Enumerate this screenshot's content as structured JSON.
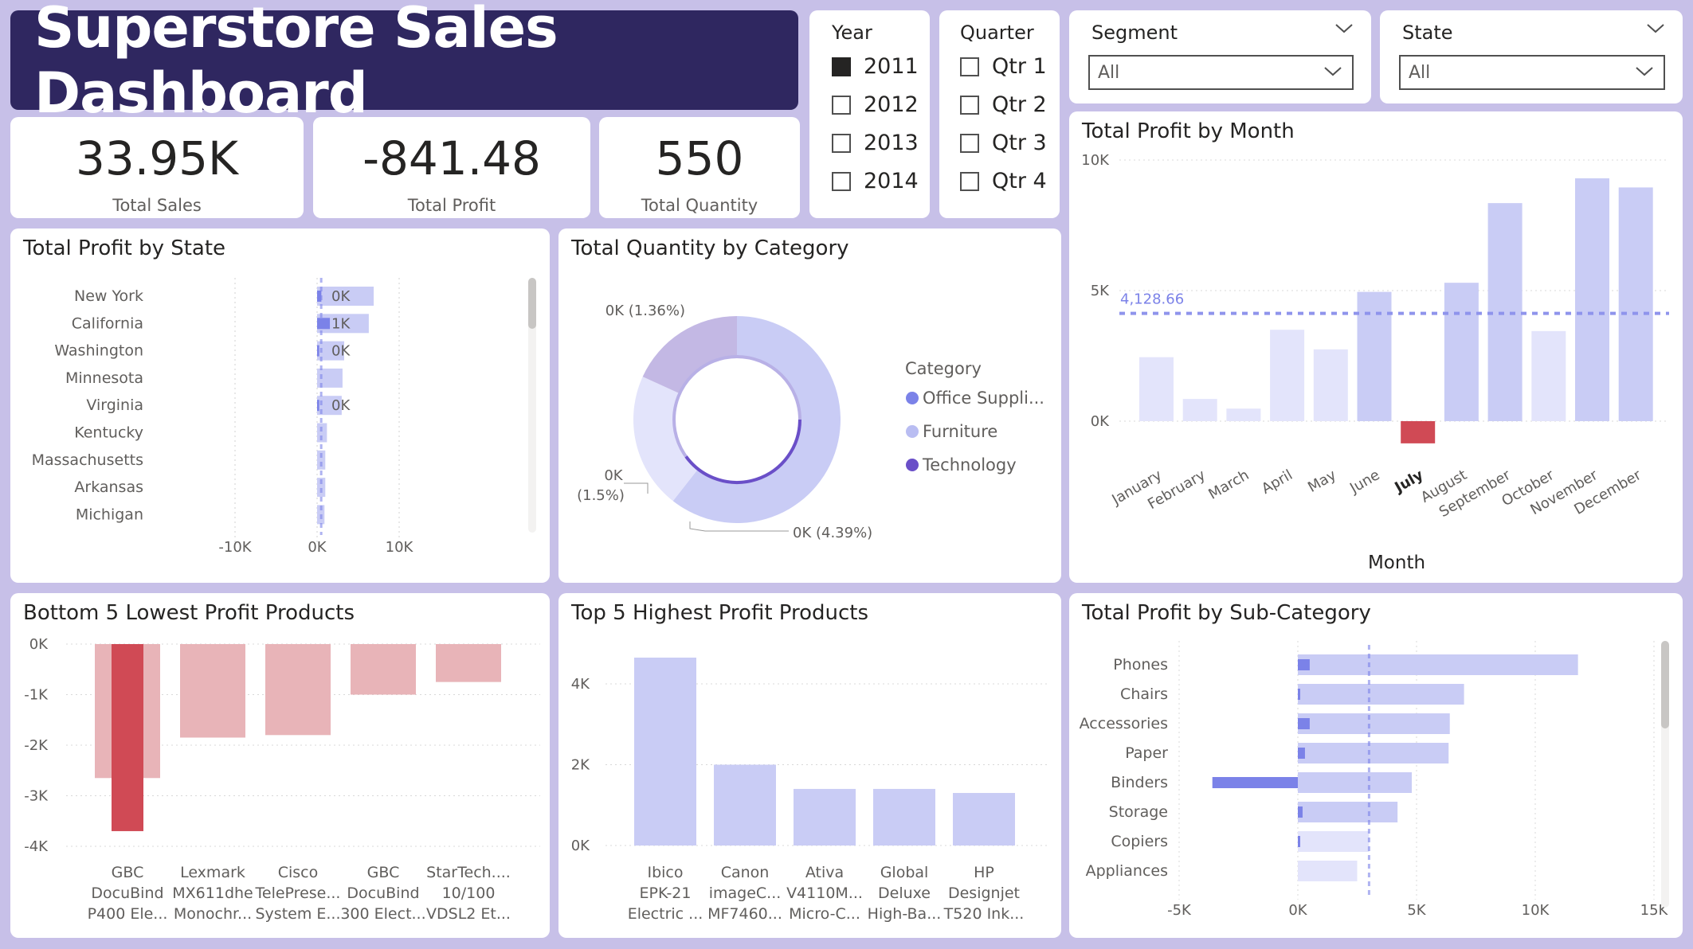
{
  "header": {
    "title": "Superstore Sales Dashboard"
  },
  "kpis": [
    {
      "value": "33.95K",
      "label": "Total Sales"
    },
    {
      "value": "-841.48",
      "label": "Total Profit"
    },
    {
      "value": "550",
      "label": "Total Quantity"
    }
  ],
  "year_slicer": {
    "title": "Year",
    "options": [
      {
        "label": "2011",
        "checked": true
      },
      {
        "label": "2012",
        "checked": false
      },
      {
        "label": "2013",
        "checked": false
      },
      {
        "label": "2014",
        "checked": false
      }
    ]
  },
  "quarter_slicer": {
    "title": "Quarter",
    "options": [
      {
        "label": "Qtr 1",
        "checked": false
      },
      {
        "label": "Qtr 2",
        "checked": false
      },
      {
        "label": "Qtr 3",
        "checked": false
      },
      {
        "label": "Qtr 4",
        "checked": false
      }
    ]
  },
  "segment_filter": {
    "title": "Segment",
    "value": "All"
  },
  "state_filter": {
    "title": "State",
    "value": "All"
  },
  "colors": {
    "background": "#c7c0e8",
    "title_bg": "#2f2760",
    "bar_light": "#c9ccf5",
    "bar_pale": "#e3e4fb",
    "bar_accent": "#7b82e8",
    "negative": "#d04a55",
    "negative_light": "#e8b4b8",
    "donut_office": "#c9ccf5",
    "donut_furniture": "#e3e4fb",
    "donut_technology": "#c3b8e4",
    "legend_office": "#7b82e8",
    "legend_furniture": "#b9bdf2",
    "legend_technology": "#6a4fc8"
  },
  "chart_data": [
    {
      "id": "profit_by_state",
      "type": "bar",
      "orientation": "horizontal",
      "title": "Total Profit by State",
      "categories": [
        "New York",
        "California",
        "Washington",
        "Minnesota",
        "Virginia",
        "Kentucky",
        "Massachusetts",
        "Arkansas",
        "Michigan"
      ],
      "series": [
        {
          "values": [
            6900,
            6300,
            3300,
            3100,
            3000,
            1200,
            1000,
            1000,
            900
          ]
        },
        {
          "values": [
            200,
            600,
            100,
            0,
            100,
            0,
            0,
            0,
            0
          ]
        }
      ],
      "data_labels": [
        "0K",
        "1K",
        "0K",
        "",
        "0K",
        "",
        "",
        "",
        ""
      ],
      "x_ticks": [
        "-10K",
        "0K",
        "10K"
      ],
      "xlim": [
        -11000,
        21000
      ],
      "reference_line": 500
    },
    {
      "id": "quantity_by_category",
      "type": "pie",
      "variant": "donut",
      "title": "Total Quantity by Category",
      "legend_title": "Category",
      "slices": [
        {
          "label": "Office Suppli...",
          "value": 60.6
        },
        {
          "label": "Furniture",
          "value": 21.2
        },
        {
          "label": "Technology",
          "value": 18.2
        }
      ],
      "inner_ring_fraction": 0.4,
      "data_labels": [
        "0K (4.39%)",
        "0K",
        "(1.5%)",
        "0K (1.36%)"
      ]
    },
    {
      "id": "profit_by_month",
      "type": "bar",
      "title": "Total Profit by Month",
      "xlabel": "Month",
      "categories": [
        "January",
        "February",
        "March",
        "April",
        "May",
        "June",
        "July",
        "August",
        "September",
        "October",
        "November",
        "December"
      ],
      "values": [
        2450,
        850,
        480,
        3500,
        2750,
        4950,
        -850,
        5300,
        8350,
        3450,
        9300,
        8950
      ],
      "y_ticks": [
        "10K",
        "5K",
        "0K"
      ],
      "ylim": [
        -1600,
        10100
      ],
      "average_line": {
        "value": 4128.66,
        "label": "4,128.66"
      },
      "highlighted_category": "July"
    },
    {
      "id": "bottom5_products",
      "type": "bar",
      "title": "Bottom 5 Lowest Profit Products",
      "categories": [
        [
          "GBC",
          "DocuBind",
          "P400 Ele..."
        ],
        [
          "Lexmark",
          "MX611dhe",
          "Monochr..."
        ],
        [
          "Cisco",
          "TelePrese...",
          "System E..."
        ],
        [
          "GBC",
          "DocuBind",
          "300 Elect..."
        ],
        [
          "StarTech....",
          "10/100",
          "VDSL2 Et..."
        ]
      ],
      "series": [
        {
          "values": [
            -2650,
            -1850,
            -1800,
            -1000,
            -750
          ]
        },
        {
          "values": [
            -3700,
            0,
            0,
            0,
            0
          ]
        }
      ],
      "y_ticks": [
        "0K",
        "-1K",
        "-2K",
        "-3K",
        "-4K"
      ],
      "ylim": [
        -4000,
        0
      ]
    },
    {
      "id": "top5_products",
      "type": "bar",
      "title": "Top 5 Highest Profit Products",
      "categories": [
        [
          "Ibico",
          "EPK-21",
          "Electric ..."
        ],
        [
          "Canon",
          "imageC...",
          "MF7460..."
        ],
        [
          "Ativa",
          "V4110M...",
          "Micro-C..."
        ],
        [
          "Global",
          "Deluxe",
          "High-Ba..."
        ],
        [
          "HP",
          "Designjet",
          "T520 Ink..."
        ]
      ],
      "values": [
        4650,
        2000,
        1400,
        1400,
        1300
      ],
      "y_ticks": [
        "4K",
        "2K",
        "0K"
      ],
      "ylim": [
        0,
        4800
      ]
    },
    {
      "id": "profit_by_subcategory",
      "type": "bar",
      "orientation": "horizontal",
      "title": "Total Profit by Sub-Category",
      "categories": [
        "Phones",
        "Chairs",
        "Accessories",
        "Paper",
        "Binders",
        "Storage",
        "Copiers",
        "Appliances"
      ],
      "series": [
        {
          "values": [
            11800,
            7000,
            6400,
            6350,
            4800,
            4200,
            3000,
            2500
          ]
        },
        {
          "values": [
            500,
            100,
            500,
            300,
            -3600,
            200,
            100,
            0
          ]
        }
      ],
      "x_ticks": [
        "-5K",
        "0K",
        "5K",
        "10K",
        "15K"
      ],
      "xlim": [
        -5000,
        15000
      ],
      "reference_line": 3000
    }
  ]
}
